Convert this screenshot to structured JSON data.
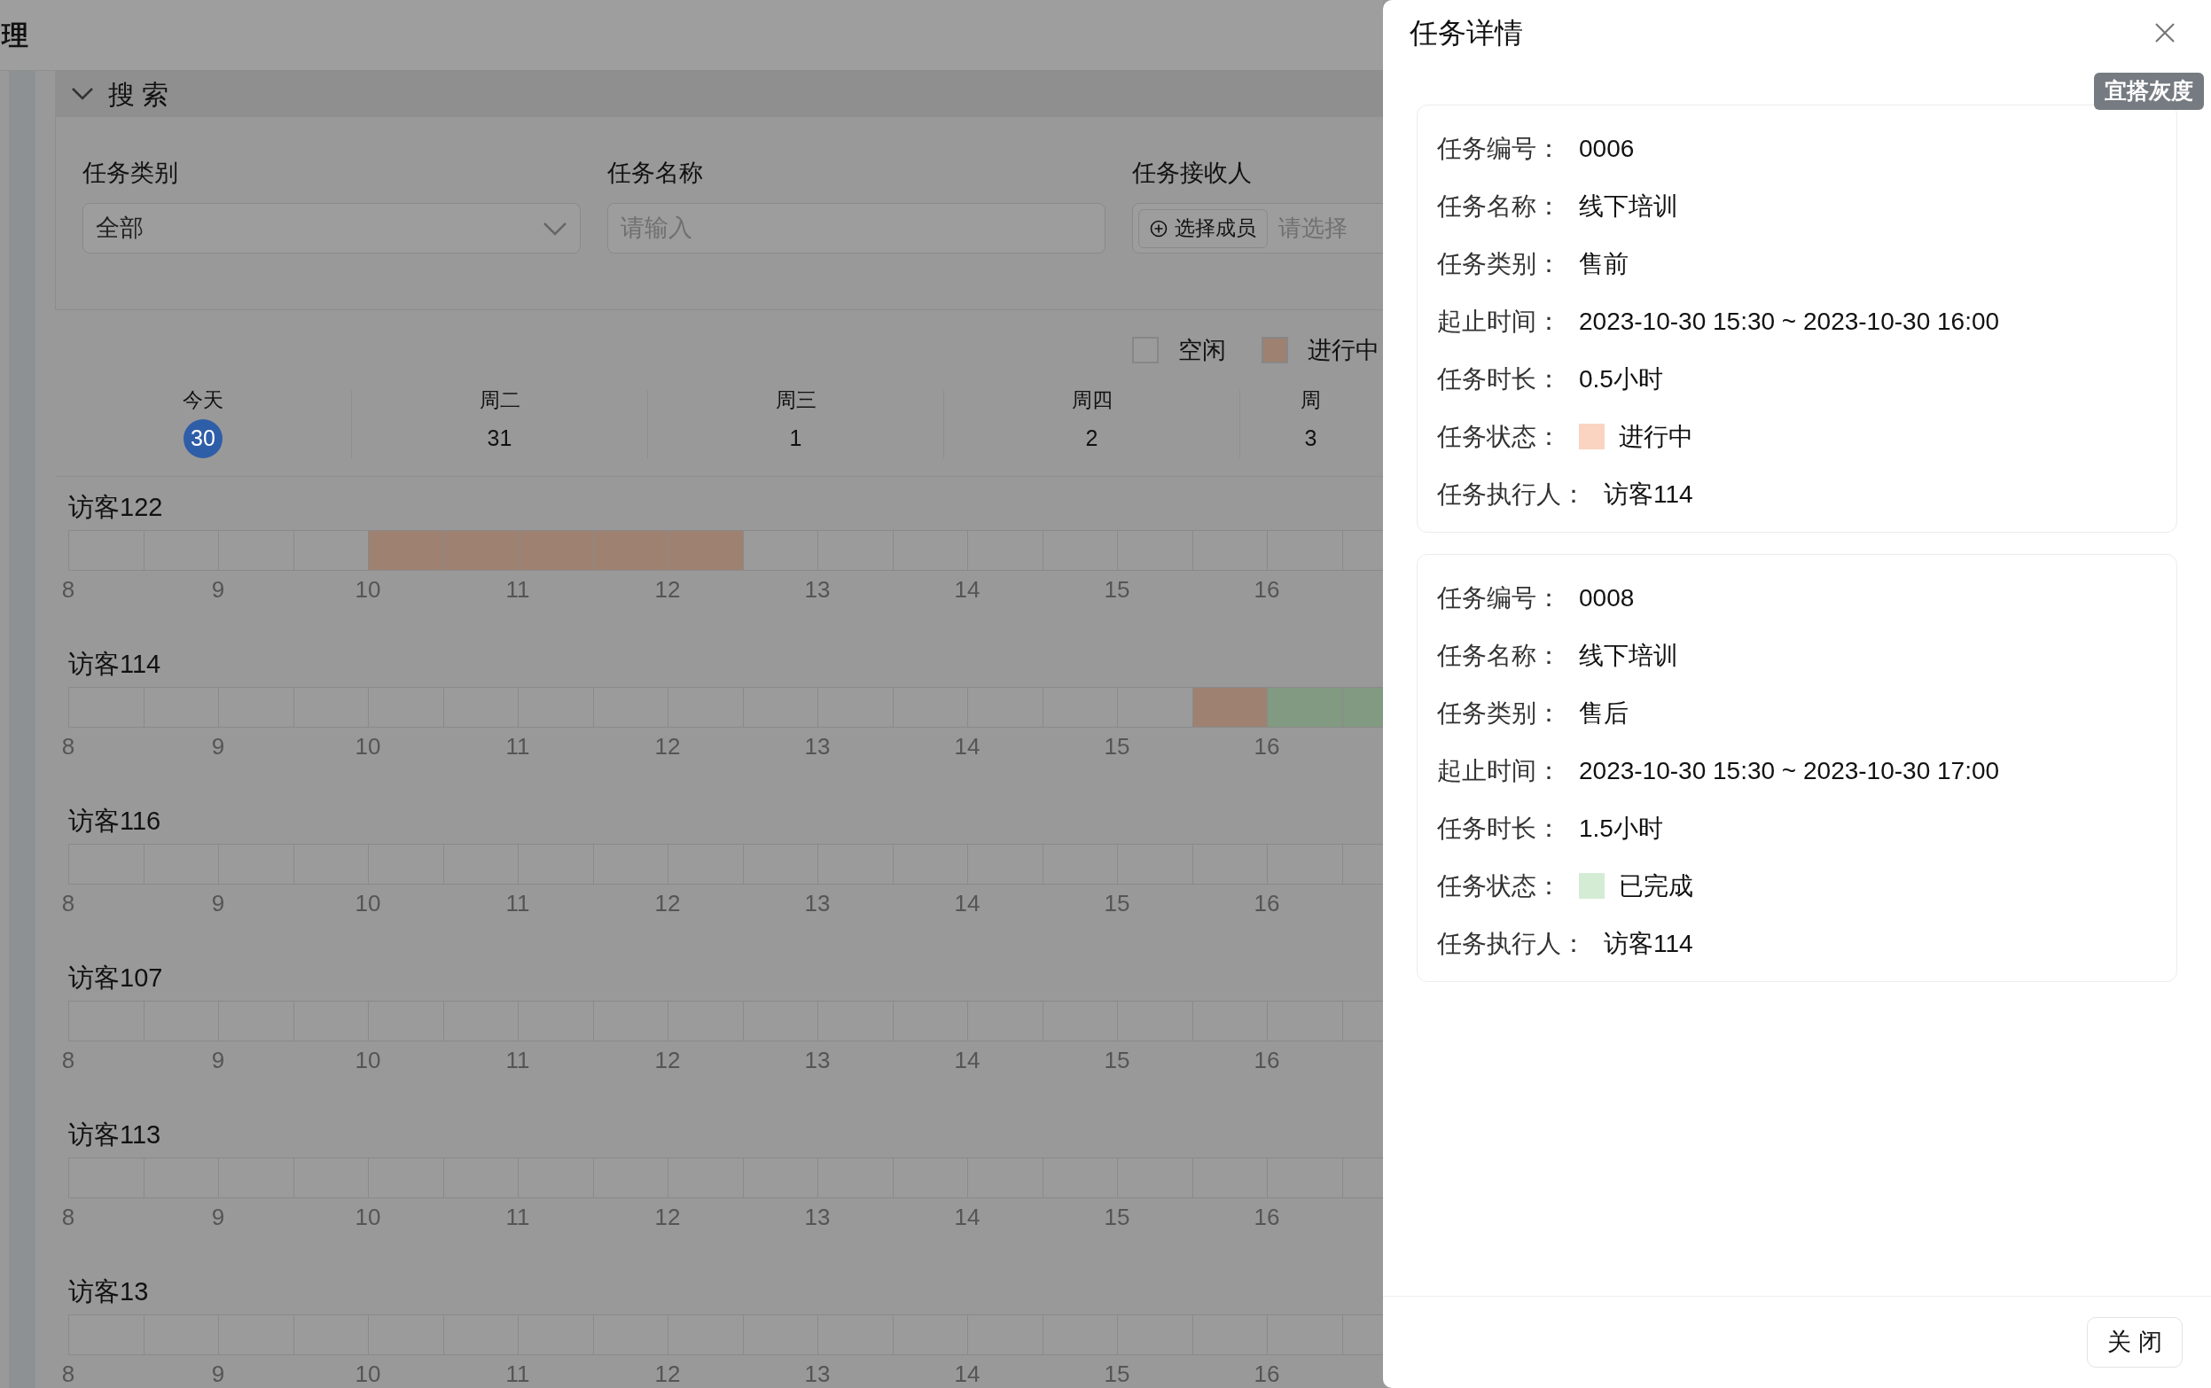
{
  "header": {
    "title": "理"
  },
  "search": {
    "title": "搜 索",
    "expanded": true,
    "filters": [
      {
        "kind": "select",
        "label": "任务类别",
        "value": "全部"
      },
      {
        "kind": "input",
        "label": "任务名称",
        "placeholder": "请输入"
      },
      {
        "kind": "member",
        "label": "任务接收人",
        "button": "选择成员",
        "placeholder": "请选择"
      }
    ]
  },
  "legend": [
    {
      "label": "空闲",
      "color": "#9b9b9b"
    },
    {
      "label": "进行中",
      "color": "#9e8171"
    }
  ],
  "days": [
    {
      "weekday": "今天",
      "date": "30",
      "selected": true
    },
    {
      "weekday": "周二",
      "date": "31",
      "selected": false
    },
    {
      "weekday": "周三",
      "date": "1",
      "selected": false
    },
    {
      "weekday": "周四",
      "date": "2",
      "selected": false
    },
    {
      "weekday": "周",
      "date": "3",
      "selected": false
    }
  ],
  "visitors": [
    {
      "name": "访客122",
      "hours": [
        "8",
        "9",
        "10",
        "11",
        "12",
        "13",
        "14",
        "15",
        "16"
      ],
      "slots": [
        {
          "kind": "idle"
        },
        {
          "kind": "idle"
        },
        {
          "kind": "idle"
        },
        {
          "kind": "idle"
        },
        {
          "kind": "in_progress"
        },
        {
          "kind": "in_progress"
        },
        {
          "kind": "in_progress"
        },
        {
          "kind": "in_progress"
        },
        {
          "kind": "in_progress"
        },
        {
          "kind": "idle"
        },
        {
          "kind": "idle"
        },
        {
          "kind": "idle"
        },
        {
          "kind": "idle"
        },
        {
          "kind": "idle"
        },
        {
          "kind": "idle"
        },
        {
          "kind": "idle"
        },
        {
          "kind": "idle"
        },
        {
          "kind": "idle"
        }
      ]
    },
    {
      "name": "访客114",
      "hours": [
        "8",
        "9",
        "10",
        "11",
        "12",
        "13",
        "14",
        "15",
        "16"
      ],
      "slots": [
        {
          "kind": "idle"
        },
        {
          "kind": "idle"
        },
        {
          "kind": "idle"
        },
        {
          "kind": "idle"
        },
        {
          "kind": "idle"
        },
        {
          "kind": "idle"
        },
        {
          "kind": "idle"
        },
        {
          "kind": "idle"
        },
        {
          "kind": "idle"
        },
        {
          "kind": "idle"
        },
        {
          "kind": "idle"
        },
        {
          "kind": "idle"
        },
        {
          "kind": "idle"
        },
        {
          "kind": "idle"
        },
        {
          "kind": "idle"
        },
        {
          "kind": "in_progress"
        },
        {
          "kind": "done"
        },
        {
          "kind": "done"
        }
      ]
    },
    {
      "name": "访客116",
      "hours": [
        "8",
        "9",
        "10",
        "11",
        "12",
        "13",
        "14",
        "15",
        "16"
      ],
      "slots": [
        {
          "kind": "idle"
        },
        {
          "kind": "idle"
        },
        {
          "kind": "idle"
        },
        {
          "kind": "idle"
        },
        {
          "kind": "idle"
        },
        {
          "kind": "idle"
        },
        {
          "kind": "idle"
        },
        {
          "kind": "idle"
        },
        {
          "kind": "idle"
        },
        {
          "kind": "idle"
        },
        {
          "kind": "idle"
        },
        {
          "kind": "idle"
        },
        {
          "kind": "idle"
        },
        {
          "kind": "idle"
        },
        {
          "kind": "idle"
        },
        {
          "kind": "idle"
        },
        {
          "kind": "idle"
        },
        {
          "kind": "idle"
        }
      ]
    },
    {
      "name": "访客107",
      "hours": [
        "8",
        "9",
        "10",
        "11",
        "12",
        "13",
        "14",
        "15",
        "16"
      ],
      "slots": [
        {
          "kind": "idle"
        },
        {
          "kind": "idle"
        },
        {
          "kind": "idle"
        },
        {
          "kind": "idle"
        },
        {
          "kind": "idle"
        },
        {
          "kind": "idle"
        },
        {
          "kind": "idle"
        },
        {
          "kind": "idle"
        },
        {
          "kind": "idle"
        },
        {
          "kind": "idle"
        },
        {
          "kind": "idle"
        },
        {
          "kind": "idle"
        },
        {
          "kind": "idle"
        },
        {
          "kind": "idle"
        },
        {
          "kind": "idle"
        },
        {
          "kind": "idle"
        },
        {
          "kind": "idle"
        },
        {
          "kind": "idle"
        }
      ]
    },
    {
      "name": "访客113",
      "hours": [
        "8",
        "9",
        "10",
        "11",
        "12",
        "13",
        "14",
        "15",
        "16"
      ],
      "slots": [
        {
          "kind": "idle"
        },
        {
          "kind": "idle"
        },
        {
          "kind": "idle"
        },
        {
          "kind": "idle"
        },
        {
          "kind": "idle"
        },
        {
          "kind": "idle"
        },
        {
          "kind": "idle"
        },
        {
          "kind": "idle"
        },
        {
          "kind": "idle"
        },
        {
          "kind": "idle"
        },
        {
          "kind": "idle"
        },
        {
          "kind": "idle"
        },
        {
          "kind": "idle"
        },
        {
          "kind": "idle"
        },
        {
          "kind": "idle"
        },
        {
          "kind": "idle"
        },
        {
          "kind": "idle"
        },
        {
          "kind": "idle"
        }
      ]
    },
    {
      "name": "访客13",
      "hours": [
        "8",
        "9",
        "10",
        "11",
        "12",
        "13",
        "14",
        "15",
        "16"
      ],
      "slots": [
        {
          "kind": "idle"
        },
        {
          "kind": "idle"
        },
        {
          "kind": "idle"
        },
        {
          "kind": "idle"
        },
        {
          "kind": "idle"
        },
        {
          "kind": "idle"
        },
        {
          "kind": "idle"
        },
        {
          "kind": "idle"
        },
        {
          "kind": "idle"
        },
        {
          "kind": "idle"
        },
        {
          "kind": "idle"
        },
        {
          "kind": "idle"
        },
        {
          "kind": "idle"
        },
        {
          "kind": "idle"
        },
        {
          "kind": "idle"
        },
        {
          "kind": "idle"
        },
        {
          "kind": "idle"
        },
        {
          "kind": "idle"
        }
      ]
    }
  ],
  "drawer": {
    "title": "任务详情",
    "badge": "宜搭灰度",
    "tasks": [
      {
        "fields": [
          {
            "label": "任务编号：",
            "value": "0006"
          },
          {
            "label": "任务名称：",
            "value": "线下培训"
          },
          {
            "label": "任务类别：",
            "value": "售前"
          },
          {
            "label": "起止时间：",
            "value": "2023-10-30 15:30 ~ 2023-10-30 16:00"
          },
          {
            "label": "任务时长：",
            "value": "0.5小时"
          },
          {
            "label": "任务状态：",
            "value": "进行中",
            "color": "#fad4c0"
          },
          {
            "label": "任务执行人：",
            "value": "访客114"
          }
        ]
      },
      {
        "fields": [
          {
            "label": "任务编号：",
            "value": "0008"
          },
          {
            "label": "任务名称：",
            "value": "线下培训"
          },
          {
            "label": "任务类别：",
            "value": "售后"
          },
          {
            "label": "起止时间：",
            "value": "2023-10-30 15:30 ~ 2023-10-30 17:00"
          },
          {
            "label": "任务时长：",
            "value": "1.5小时"
          },
          {
            "label": "任务状态：",
            "value": "已完成",
            "color": "#d4ecd4"
          },
          {
            "label": "任务执行人：",
            "value": "访客114"
          }
        ]
      }
    ],
    "footer_button": "关 闭"
  }
}
